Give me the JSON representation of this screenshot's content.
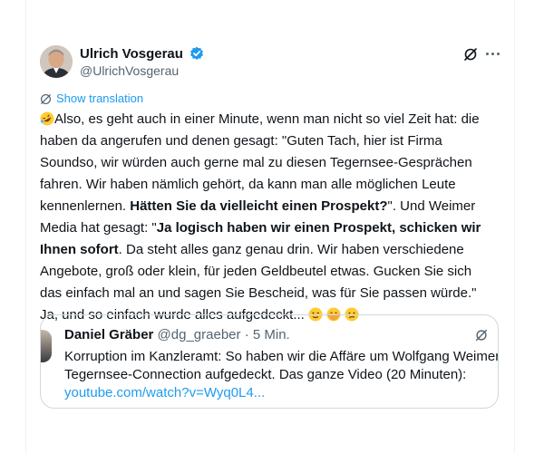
{
  "tweet": {
    "author": {
      "name": "Ulrich Vosgerau",
      "handle": "@UlrichVosgerau"
    },
    "show_translation": "Show translation",
    "lines": [
      "Also, es geht auch in einer Minute, wenn man nicht so viel Zeit hat: die",
      "haben da angerufen und denen gesagt: \"Guten Tach, hier ist Firma",
      "Soundso, wir würden auch gerne mal zu diesen Tegernsee-Gesprächen",
      "fahren. Wir haben nämlich gehört, da kann man alle möglichen Leute",
      "Media hat gesagt: \"",
      "Angebote, groß oder klein, für jeden Geldbeutel etwas. Gucken Sie sich",
      "das einfach mal an und sagen Sie Bescheid, was für Sie passen würde.\"",
      "Ja, und so einfach wurde alles aufgedeckt..."
    ],
    "line5_prefix": "kennenlernen. ",
    "line5_bold": "Hätten Sie da vielleicht einen Prospekt?",
    "line5_suffix": "\". Und Weimer",
    "line6_bold": "Ja logisch haben wir einen Prospekt, schicken wir",
    "line7_bold": "Ihnen sofort",
    "line7_suffix": ". Da steht alles ganz genau drin. Wir haben verschiedene",
    "emojis": [
      "rolling-on-floor-laughing",
      "winking-face",
      "face-with-hand-over-mouth",
      "confused-face"
    ]
  },
  "quote": {
    "name": "Daniel Gräber",
    "handle": "@dg_graeber",
    "separator": "·",
    "time": "5 Min.",
    "line1": "Korruption im Kanzleramt: So haben wir die Affäre um Wolfgang Weimers",
    "line2": "Tegernsee-Connection aufgedeckt. Das ganze Video (20 Minuten):",
    "link": "youtube.com/watch?v=Wyq0L4..."
  },
  "colors": {
    "accent": "#1d9bf0",
    "text": "#0f1419",
    "secondary": "#536471",
    "border": "#cfd9de"
  }
}
